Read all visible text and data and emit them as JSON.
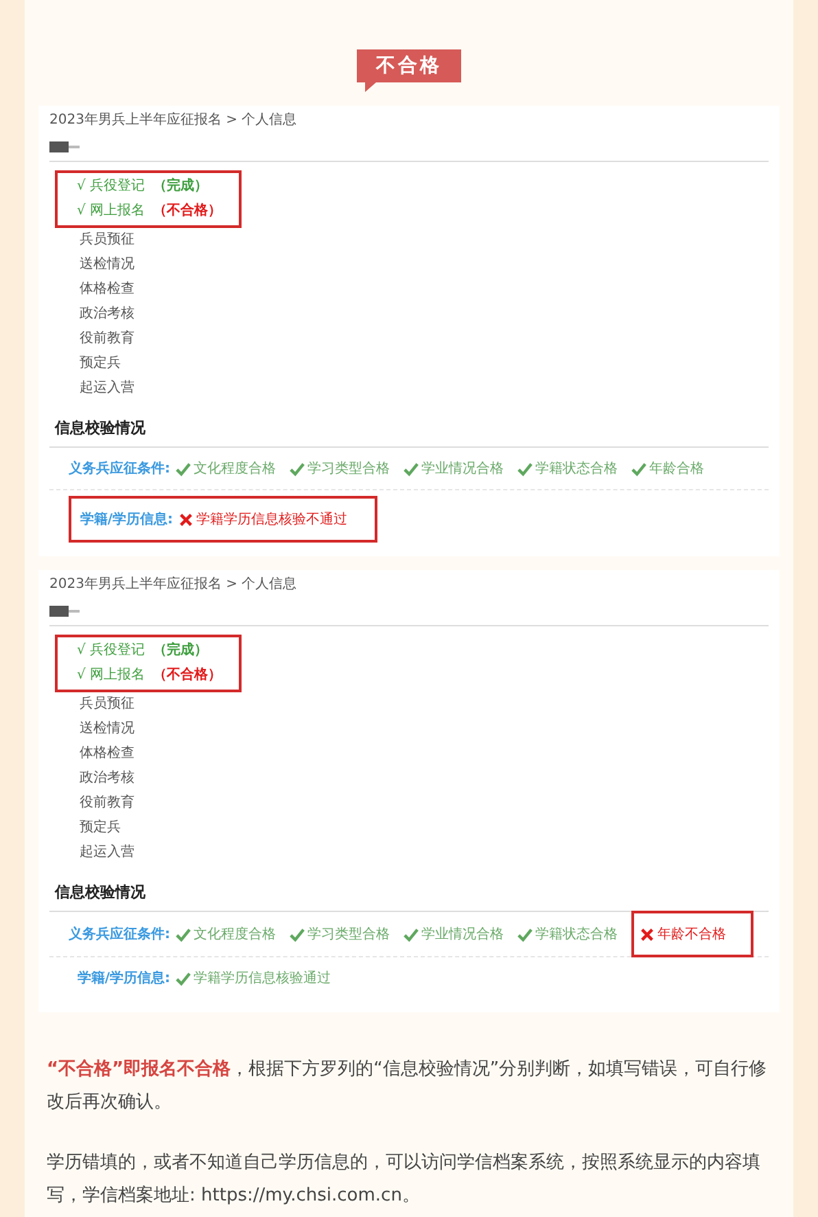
{
  "banner": {
    "text": "不合格"
  },
  "screenshots": [
    {
      "breadcrumb": "2023年男兵上半年应征报名 > 个人信息",
      "steps": [
        {
          "label": "√ 兵役登记",
          "status": "（完成）",
          "status_passed": true,
          "done": true,
          "highlighted": true
        },
        {
          "label": "√ 网上报名",
          "status": "（不合格）",
          "status_passed": false,
          "done": true,
          "highlighted": true
        },
        {
          "label": "兵员预征",
          "done": false,
          "highlighted": false
        },
        {
          "label": "送检情况",
          "done": false,
          "highlighted": false
        },
        {
          "label": "体格检查",
          "done": false,
          "highlighted": false
        },
        {
          "label": "政治考核",
          "done": false,
          "highlighted": false
        },
        {
          "label": "役前教育",
          "done": false,
          "highlighted": false
        },
        {
          "label": "预定兵",
          "done": false,
          "highlighted": false
        },
        {
          "label": "起运入营",
          "done": false,
          "highlighted": false
        }
      ],
      "check_title": "信息校验情况",
      "check_rows": [
        {
          "label": "义务兵应征条件:",
          "highlighted": false,
          "items": [
            {
              "text": "文化程度合格",
              "passed": true,
              "highlighted": false
            },
            {
              "text": "学习类型合格",
              "passed": true,
              "highlighted": false
            },
            {
              "text": "学业情况合格",
              "passed": true,
              "highlighted": false
            },
            {
              "text": "学籍状态合格",
              "passed": true,
              "highlighted": false
            },
            {
              "text": "年龄合格",
              "passed": true,
              "highlighted": false
            }
          ]
        },
        {
          "label": "学籍/学历信息:",
          "highlighted": true,
          "items": [
            {
              "text": "学籍学历信息核验不通过",
              "passed": false,
              "highlighted": false
            }
          ]
        }
      ]
    },
    {
      "breadcrumb": "2023年男兵上半年应征报名 > 个人信息",
      "steps": [
        {
          "label": "√ 兵役登记",
          "status": "（完成）",
          "status_passed": true,
          "done": true,
          "highlighted": true
        },
        {
          "label": "√ 网上报名",
          "status": "（不合格）",
          "status_passed": false,
          "done": true,
          "highlighted": true
        },
        {
          "label": "兵员预征",
          "done": false,
          "highlighted": false
        },
        {
          "label": "送检情况",
          "done": false,
          "highlighted": false
        },
        {
          "label": "体格检查",
          "done": false,
          "highlighted": false
        },
        {
          "label": "政治考核",
          "done": false,
          "highlighted": false
        },
        {
          "label": "役前教育",
          "done": false,
          "highlighted": false
        },
        {
          "label": "预定兵",
          "done": false,
          "highlighted": false
        },
        {
          "label": "起运入营",
          "done": false,
          "highlighted": false
        }
      ],
      "check_title": "信息校验情况",
      "check_rows": [
        {
          "label": "义务兵应征条件:",
          "highlighted": false,
          "items": [
            {
              "text": "文化程度合格",
              "passed": true,
              "highlighted": false
            },
            {
              "text": "学习类型合格",
              "passed": true,
              "highlighted": false
            },
            {
              "text": "学业情况合格",
              "passed": true,
              "highlighted": false
            },
            {
              "text": "学籍状态合格",
              "passed": true,
              "highlighted": false
            },
            {
              "text": "年龄不合格",
              "passed": false,
              "highlighted": true
            }
          ]
        },
        {
          "label": "学籍/学历信息:",
          "highlighted": false,
          "items": [
            {
              "text": "学籍学历信息核验通过",
              "passed": true,
              "highlighted": false
            }
          ]
        }
      ]
    }
  ],
  "paragraphs": [
    "**“不合格”即报名不合格**，根据下方罗列的“信息校验情况”分别判断，如填写错误，可自行修改后再次确认。",
    "学历错填的，或者不知道自己学历信息的，可以访问学信档案系统，按照系统显示的内容填写，学信档案地址: https://my.chsi.com.cn。"
  ]
}
